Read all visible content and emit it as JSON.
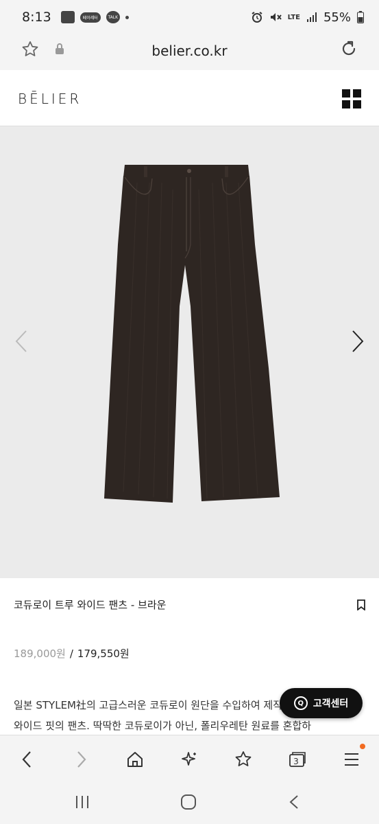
{
  "status_bar": {
    "time": "8:13",
    "notif_pill": "페이레터",
    "notif_talk": "TALK",
    "network": "LTE",
    "battery": "55%"
  },
  "browser": {
    "url": "belier.co.kr"
  },
  "site": {
    "logo": "BĒLIER"
  },
  "product": {
    "name": "코듀로이 트루 와이드 팬츠 - 브라운",
    "original_price": "189,000원",
    "separator": "/",
    "sale_price": "179,550원",
    "description_lines": [
      "일본 STYLEM社의 고급스러운 코듀로이 원단을 수입하여 제작한",
      "와이드 핏의 팬츠. 딱딱한 코듀로이가 아닌, 폴리우레탄 원료를 혼합하"
    ]
  },
  "customer_center": {
    "label": "고객센터",
    "icon_letter": "Q"
  },
  "toolbar": {
    "tab_count": "3"
  },
  "colors": {
    "accent_badge": "#f26b21",
    "pants": "#2e2622",
    "background_image": "#ebebeb"
  }
}
